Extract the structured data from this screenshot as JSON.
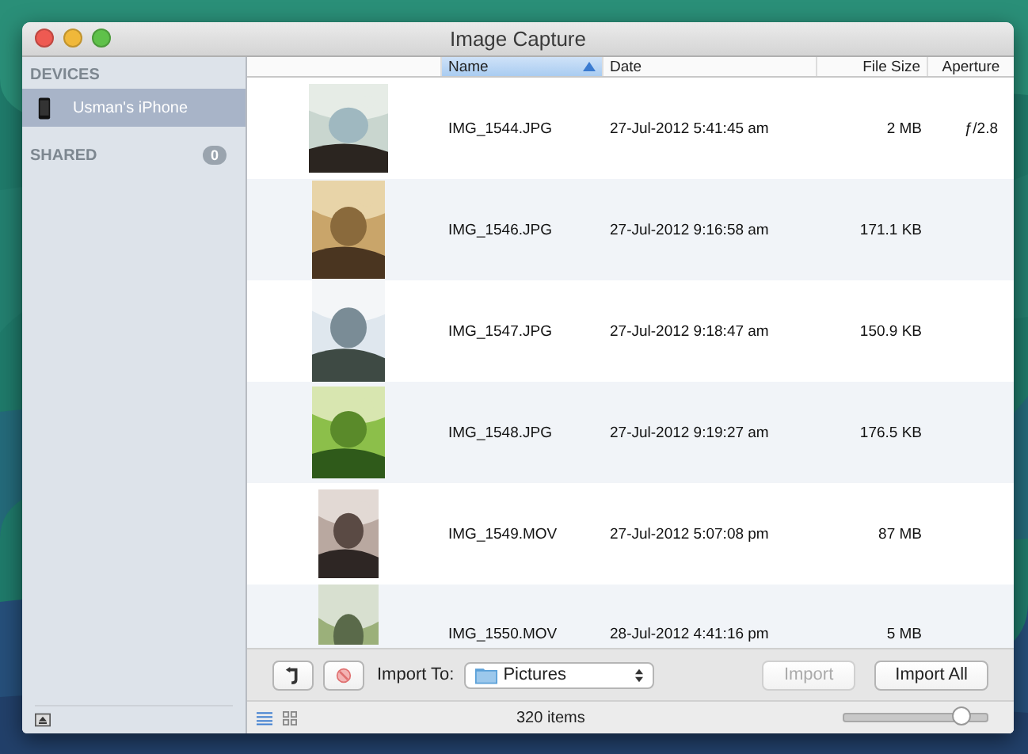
{
  "window": {
    "title": "Image Capture"
  },
  "sidebar": {
    "sections": [
      {
        "heading": "DEVICES",
        "items": [
          {
            "name": "Usman's iPhone",
            "selected": true
          }
        ]
      },
      {
        "heading": "SHARED",
        "badge": "0"
      }
    ]
  },
  "table": {
    "columns": [
      {
        "label": "Name",
        "sorted": true
      },
      {
        "label": "Date",
        "sorted": false
      },
      {
        "label": "File Size",
        "sorted": false
      },
      {
        "label": "Aperture",
        "sorted": false
      }
    ],
    "rows": [
      {
        "name": "IMG_1544.JPG",
        "date": "27-Jul-2012 5:41:45 am",
        "size": "2 MB",
        "aperture": "ƒ/2.8"
      },
      {
        "name": "IMG_1546.JPG",
        "date": "27-Jul-2012 9:16:58 am",
        "size": "171.1 KB"
      },
      {
        "name": "IMG_1547.JPG",
        "date": "27-Jul-2012 9:18:47 am",
        "size": "150.9 KB"
      },
      {
        "name": "IMG_1548.JPG",
        "date": "27-Jul-2012 9:19:27 am",
        "size": "176.5 KB"
      },
      {
        "name": "IMG_1549.MOV",
        "date": "27-Jul-2012 5:07:08 pm",
        "size": "87 MB"
      },
      {
        "name": "IMG_1550.MOV",
        "date": "28-Jul-2012 4:41:16 pm",
        "size": "5 MB"
      }
    ]
  },
  "toolbar": {
    "import_label": "Import To:",
    "destination": "Pictures",
    "buttons": [
      {
        "label": "Import",
        "disabled": true
      },
      {
        "label": "Import All",
        "disabled": false
      }
    ]
  },
  "status_bar": {
    "views": [
      {
        "kind": "list",
        "selected": true
      },
      {
        "kind": "grid",
        "selected": false
      }
    ],
    "count": "320 items",
    "zoom": {
      "level": 0.82
    }
  }
}
